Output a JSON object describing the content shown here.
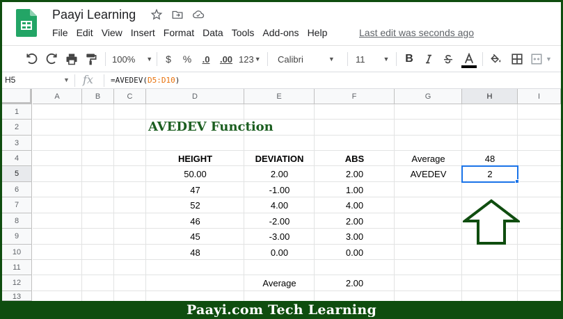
{
  "app": {
    "doc_title": "Paayi Learning",
    "last_edit": "Last edit was seconds ago"
  },
  "menu": [
    "File",
    "Edit",
    "View",
    "Insert",
    "Format",
    "Data",
    "Tools",
    "Add-ons",
    "Help"
  ],
  "toolbar": {
    "zoom": "100%",
    "currency": "$",
    "percent": "%",
    "decrease_decimal": ".0",
    "increase_decimal": ".00",
    "more_formats": "123",
    "font": "Calibri",
    "font_size": "11",
    "bold": "B",
    "text_color_accent": "#000000"
  },
  "formula_bar": {
    "cell_ref": "H5",
    "fx": "fx",
    "formula_prefix": "=AVEDEV(",
    "formula_range": "D5:D10",
    "formula_suffix": ")"
  },
  "grid": {
    "columns": [
      "A",
      "B",
      "C",
      "D",
      "E",
      "F",
      "G",
      "H",
      "I"
    ],
    "selected_column": "H",
    "rows": [
      "1",
      "2",
      "3",
      "4",
      "5",
      "6",
      "7",
      "8",
      "9",
      "10",
      "11",
      "12",
      "13"
    ],
    "selected_row": "5",
    "title": "AVEDEV Function",
    "headers": {
      "height": "HEIGHT",
      "deviation": "DEVIATION",
      "abs": "ABS"
    },
    "data_rows": [
      {
        "height": "50.00",
        "deviation": "2.00",
        "abs": "2.00"
      },
      {
        "height": "47",
        "deviation": "-1.00",
        "abs": "1.00"
      },
      {
        "height": "52",
        "deviation": "4.00",
        "abs": "4.00"
      },
      {
        "height": "46",
        "deviation": "-2.00",
        "abs": "2.00"
      },
      {
        "height": "45",
        "deviation": "-3.00",
        "abs": "3.00"
      },
      {
        "height": "48",
        "deviation": "0.00",
        "abs": "0.00"
      }
    ],
    "average_label_g": "Average",
    "average_value_h": "48",
    "avedev_label": "AVEDEV",
    "avedev_value": "2",
    "row12_label": "Average",
    "row12_value": "2.00",
    "title_color": "#1b5e20",
    "selection_color": "#1a73e8"
  },
  "footer": {
    "text": "Paayi.com Tech Learning",
    "color": "#0f4d0f"
  },
  "icons": [
    "sheets-logo",
    "star-icon",
    "move-folder-icon",
    "cloud-saved-icon",
    "undo-icon",
    "redo-icon",
    "print-icon",
    "paint-format-icon",
    "text-color-icon",
    "fill-color-icon",
    "borders-icon",
    "merge-cells-icon",
    "up-arrow-icon"
  ]
}
